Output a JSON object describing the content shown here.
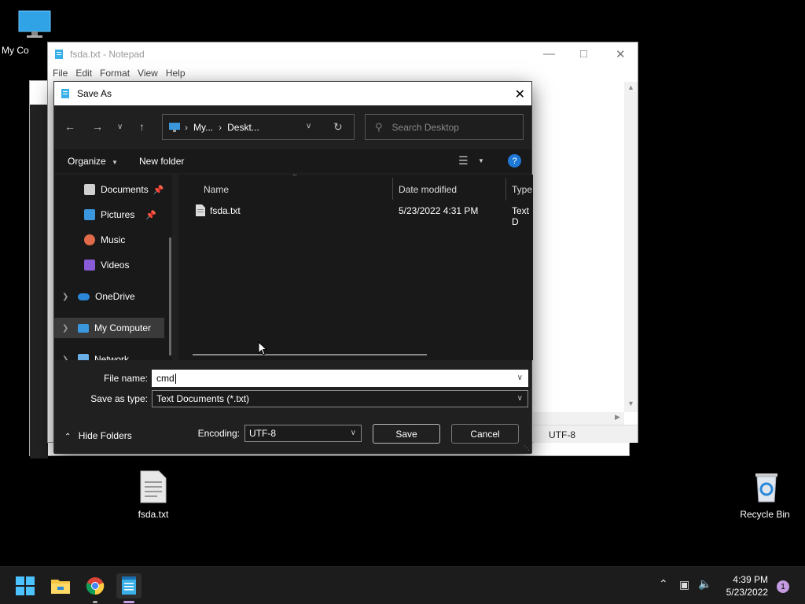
{
  "desktop": {
    "icons": [
      {
        "label": "My Co"
      },
      {
        "label": "fsda.txt"
      },
      {
        "label": "Recycle Bin"
      }
    ]
  },
  "notepad": {
    "title": "fsda.txt - Notepad",
    "menu": [
      "File",
      "Edit",
      "Format",
      "View",
      "Help"
    ],
    "status_encoding": "UTF-8"
  },
  "dialog": {
    "title": "Save As",
    "breadcrumb": [
      "My...",
      "Deskt..."
    ],
    "search_placeholder": "Search Desktop",
    "organize_label": "Organize",
    "new_folder_label": "New folder",
    "nav_items": [
      {
        "label": "Documents",
        "pinned": true
      },
      {
        "label": "Pictures",
        "pinned": true
      },
      {
        "label": "Music"
      },
      {
        "label": "Videos"
      },
      {
        "label": "OneDrive"
      },
      {
        "label": "My Computer",
        "selected": true
      },
      {
        "label": "Network"
      }
    ],
    "columns": {
      "name": "Name",
      "date": "Date modified",
      "type": "Type"
    },
    "files": [
      {
        "name": "fsda.txt",
        "date": "5/23/2022 4:31 PM",
        "type": "Text D"
      }
    ],
    "file_name_label": "File name:",
    "file_name_value": "cmd",
    "save_type_label": "Save as type:",
    "save_type_value": "Text Documents (*.txt)",
    "hide_folders_label": "Hide Folders",
    "encoding_label": "Encoding:",
    "encoding_value": "UTF-8",
    "save_label": "Save",
    "cancel_label": "Cancel"
  },
  "taskbar": {
    "time": "4:39 PM",
    "date": "5/23/2022",
    "notification_count": "1"
  },
  "colors": {
    "accent": "#3a96dd",
    "dialog_bg": "#202020",
    "pane_bg": "#191919"
  }
}
